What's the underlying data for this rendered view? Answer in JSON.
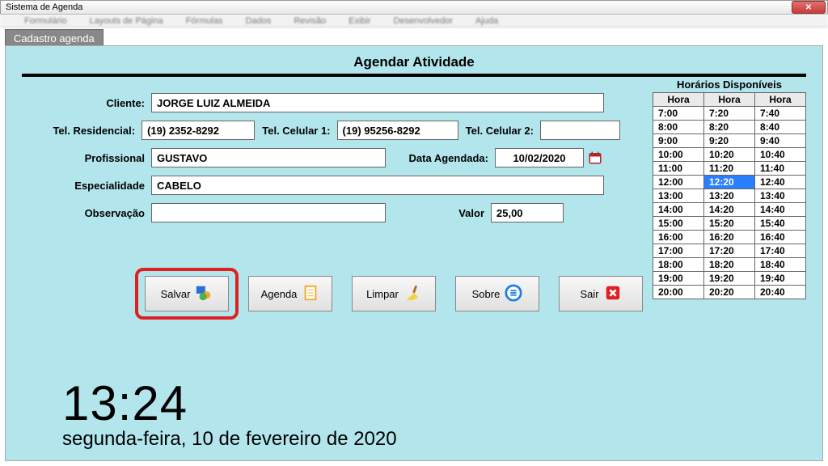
{
  "window": {
    "title": "Sistema de Agenda"
  },
  "tab": {
    "label": "Cadastro agenda"
  },
  "page": {
    "title": "Agendar Atividade"
  },
  "labels": {
    "cliente": "Cliente:",
    "tel_res": "Tel. Residencial:",
    "tel_cel1": "Tel. Celular 1:",
    "tel_cel2": "Tel. Celular 2:",
    "profissional": "Profissional",
    "data_agendada": "Data Agendada:",
    "especialidade": "Especialidade",
    "observacao": "Observação",
    "valor": "Valor"
  },
  "fields": {
    "cliente": "JORGE LUIZ ALMEIDA",
    "tel_res": "(19) 2352-8292",
    "tel_cel1": "(19) 95256-8292",
    "tel_cel2": "",
    "profissional": "GUSTAVO",
    "data_agendada": "10/02/2020",
    "especialidade": "CABELO",
    "observacao": "",
    "valor": "25,00"
  },
  "hours": {
    "title": "Horários Disponíveis",
    "header": [
      "Hora",
      "Hora",
      "Hora"
    ],
    "rows": [
      [
        "7:00",
        "7:20",
        "7:40"
      ],
      [
        "8:00",
        "8:20",
        "8:40"
      ],
      [
        "9:00",
        "9:20",
        "9:40"
      ],
      [
        "10:00",
        "10:20",
        "10:40"
      ],
      [
        "11:00",
        "11:20",
        "11:40"
      ],
      [
        "12:00",
        "12:20",
        "12:40"
      ],
      [
        "13:00",
        "13:20",
        "13:40"
      ],
      [
        "14:00",
        "14:20",
        "14:40"
      ],
      [
        "15:00",
        "15:20",
        "15:40"
      ],
      [
        "16:00",
        "16:20",
        "16:40"
      ],
      [
        "17:00",
        "17:20",
        "17:40"
      ],
      [
        "18:00",
        "18:20",
        "18:40"
      ],
      [
        "19:00",
        "19:20",
        "19:40"
      ],
      [
        "20:00",
        "20:20",
        "20:40"
      ]
    ],
    "selected": "12:20"
  },
  "buttons": {
    "salvar": "Salvar",
    "agenda": "Agenda",
    "limpar": "Limpar",
    "sobre": "Sobre",
    "sair": "Sair"
  },
  "clock": {
    "time": "13:24",
    "date": "segunda-feira, 10 de fevereiro de 2020"
  },
  "menu_blur": [
    "Formulário",
    "Layouts de Página",
    "Fórmulas",
    "Dados",
    "Revisão",
    "Exibir",
    "Desenvolvedor",
    "Ajuda"
  ]
}
